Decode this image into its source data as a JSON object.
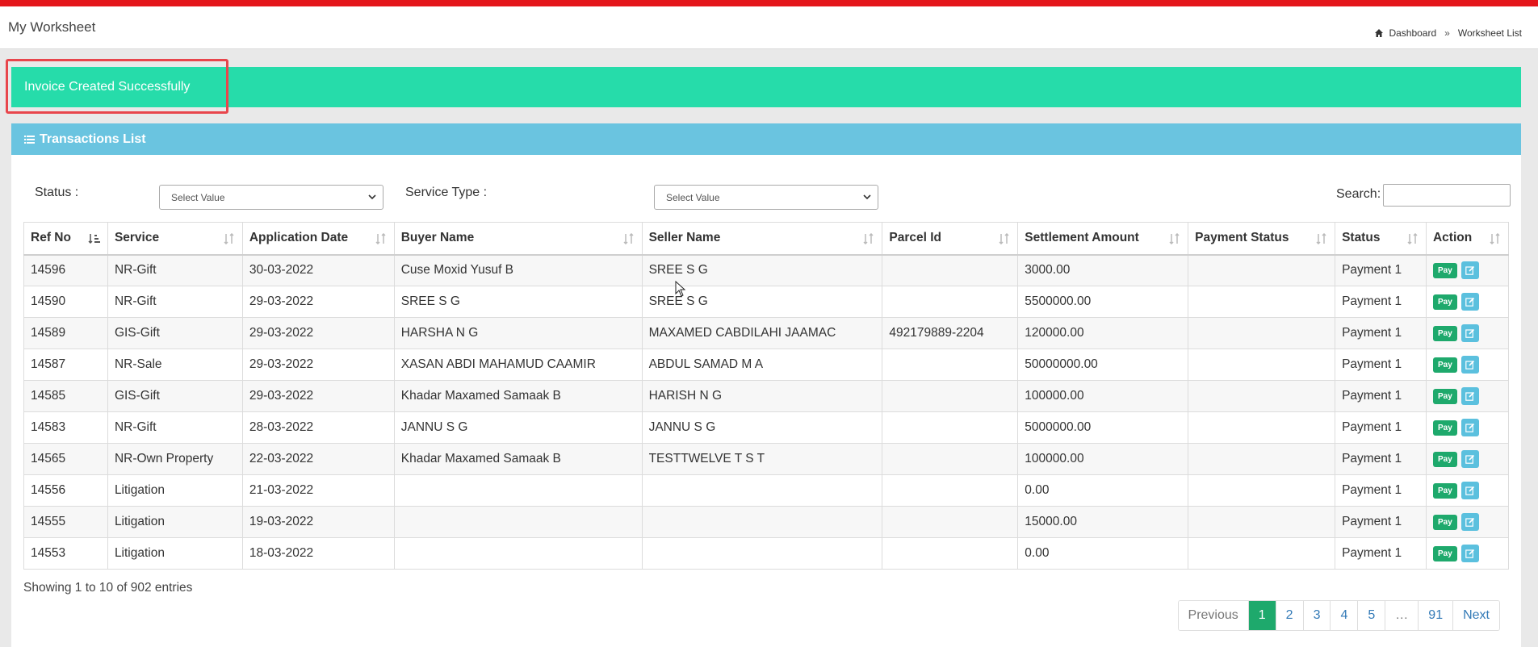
{
  "header": {
    "title": "My Worksheet",
    "breadcrumb": [
      "Dashboard",
      "Worksheet List"
    ],
    "separator": "»"
  },
  "alert": {
    "message": "Invoice Created Successfully",
    "color": "#26dcaa"
  },
  "panel": {
    "title": "Transactions List"
  },
  "filters": {
    "status_label": "Status :",
    "status_value": "Select Value",
    "service_type_label": "Service Type :",
    "service_type_value": "Select Value",
    "search_label": "Search:"
  },
  "table": {
    "columns": [
      "Ref No",
      "Service",
      "Application Date",
      "Buyer Name",
      "Seller Name",
      "Parcel Id",
      "Settlement Amount",
      "Payment Status",
      "Status",
      "Action"
    ],
    "rows": [
      [
        "14596",
        "NR-Gift",
        "30-03-2022",
        "Cuse Moxid Yusuf B",
        "SREE S G",
        "",
        "3000.00",
        "",
        "Payment 1"
      ],
      [
        "14590",
        "NR-Gift",
        "29-03-2022",
        "SREE S G",
        "SREE S G",
        "",
        "5500000.00",
        "",
        "Payment 1"
      ],
      [
        "14589",
        "GIS-Gift",
        "29-03-2022",
        "HARSHA N G",
        "MAXAMED CABDILAHI JAAMAC",
        "492179889-2204",
        "120000.00",
        "",
        "Payment 1"
      ],
      [
        "14587",
        "NR-Sale",
        "29-03-2022",
        "XASAN ABDI MAHAMUD CAAMIR",
        "ABDUL SAMAD M A",
        "",
        "50000000.00",
        "",
        "Payment 1"
      ],
      [
        "14585",
        "GIS-Gift",
        "29-03-2022",
        "Khadar Maxamed Samaak B",
        "HARISH N G",
        "",
        "100000.00",
        "",
        "Payment 1"
      ],
      [
        "14583",
        "NR-Gift",
        "28-03-2022",
        "JANNU S G",
        "JANNU S G",
        "",
        "5000000.00",
        "",
        "Payment 1"
      ],
      [
        "14565",
        "NR-Own Property",
        "22-03-2022",
        "Khadar Maxamed Samaak B",
        "TESTTWELVE T S T",
        "",
        "100000.00",
        "",
        "Payment 1"
      ],
      [
        "14556",
        "Litigation",
        "21-03-2022",
        "",
        "",
        "",
        "0.00",
        "",
        "Payment 1"
      ],
      [
        "14555",
        "Litigation",
        "19-03-2022",
        "",
        "",
        "",
        "15000.00",
        "",
        "Payment 1"
      ],
      [
        "14553",
        "Litigation",
        "18-03-2022",
        "",
        "",
        "",
        "0.00",
        "",
        "Payment 1"
      ]
    ],
    "action_pay_label": "Pay"
  },
  "info": "Showing 1 to 10 of 902 entries",
  "pagination": {
    "previous": "Previous",
    "pages": [
      "1",
      "2",
      "3",
      "4",
      "5",
      "…",
      "91"
    ],
    "active": "1",
    "next": "Next"
  }
}
